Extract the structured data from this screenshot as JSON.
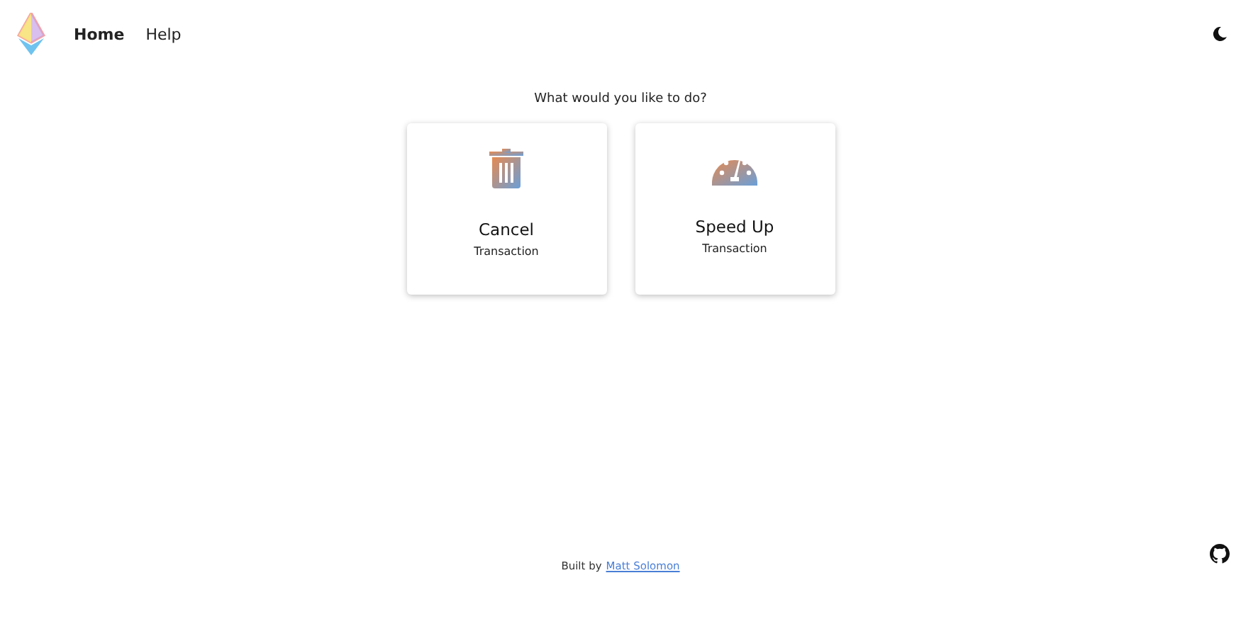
{
  "nav": [
    {
      "label": "Home",
      "selected": true
    },
    {
      "label": "Help",
      "selected": false
    }
  ],
  "prompt": "What would you like to do?",
  "actions": [
    {
      "kind": "cancel",
      "title": "Cancel",
      "subtitle": "Transaction"
    },
    {
      "kind": "speed",
      "title": "Speed Up",
      "subtitle": "Transaction"
    }
  ],
  "footer": {
    "text": "Built by",
    "link": "Matt Solomon"
  }
}
